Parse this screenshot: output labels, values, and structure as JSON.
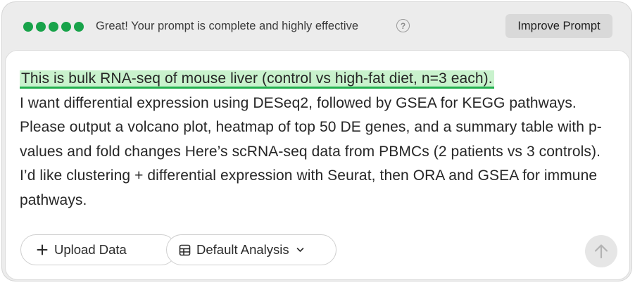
{
  "status": {
    "rating_dots": 5,
    "rating_color": "#18a34a",
    "message": "Great! Your prompt is complete and highly effective",
    "help_icon": "question-circle-icon",
    "improve_button_label": "Improve Prompt"
  },
  "prompt": {
    "highlighted_sentence": "This is bulk RNA-seq of mouse liver (control vs high-fat diet, n=3 each).",
    "rest_text": "I want differential expression using DESeq2, followed by GSEA for KEGG pathways. Please output a volcano plot, heatmap of top 50 DE genes, and a summary table with p-values and fold changes Here’s scRNA-seq data from PBMCs (2 patients vs 3 controls). I’d like clustering + differential expression with Seurat, then ORA and GSEA for immune pathways.",
    "highlight_bg_color": "#c9f2cd",
    "highlight_underline_color": "#22b04d"
  },
  "toolbar": {
    "upload_label": "Upload Data",
    "upload_icon": "plus-icon",
    "analysis_label": "Default Analysis",
    "analysis_icon": "table-icon",
    "analysis_caret_icon": "chevron-down-icon",
    "send_icon": "arrow-up-icon"
  }
}
